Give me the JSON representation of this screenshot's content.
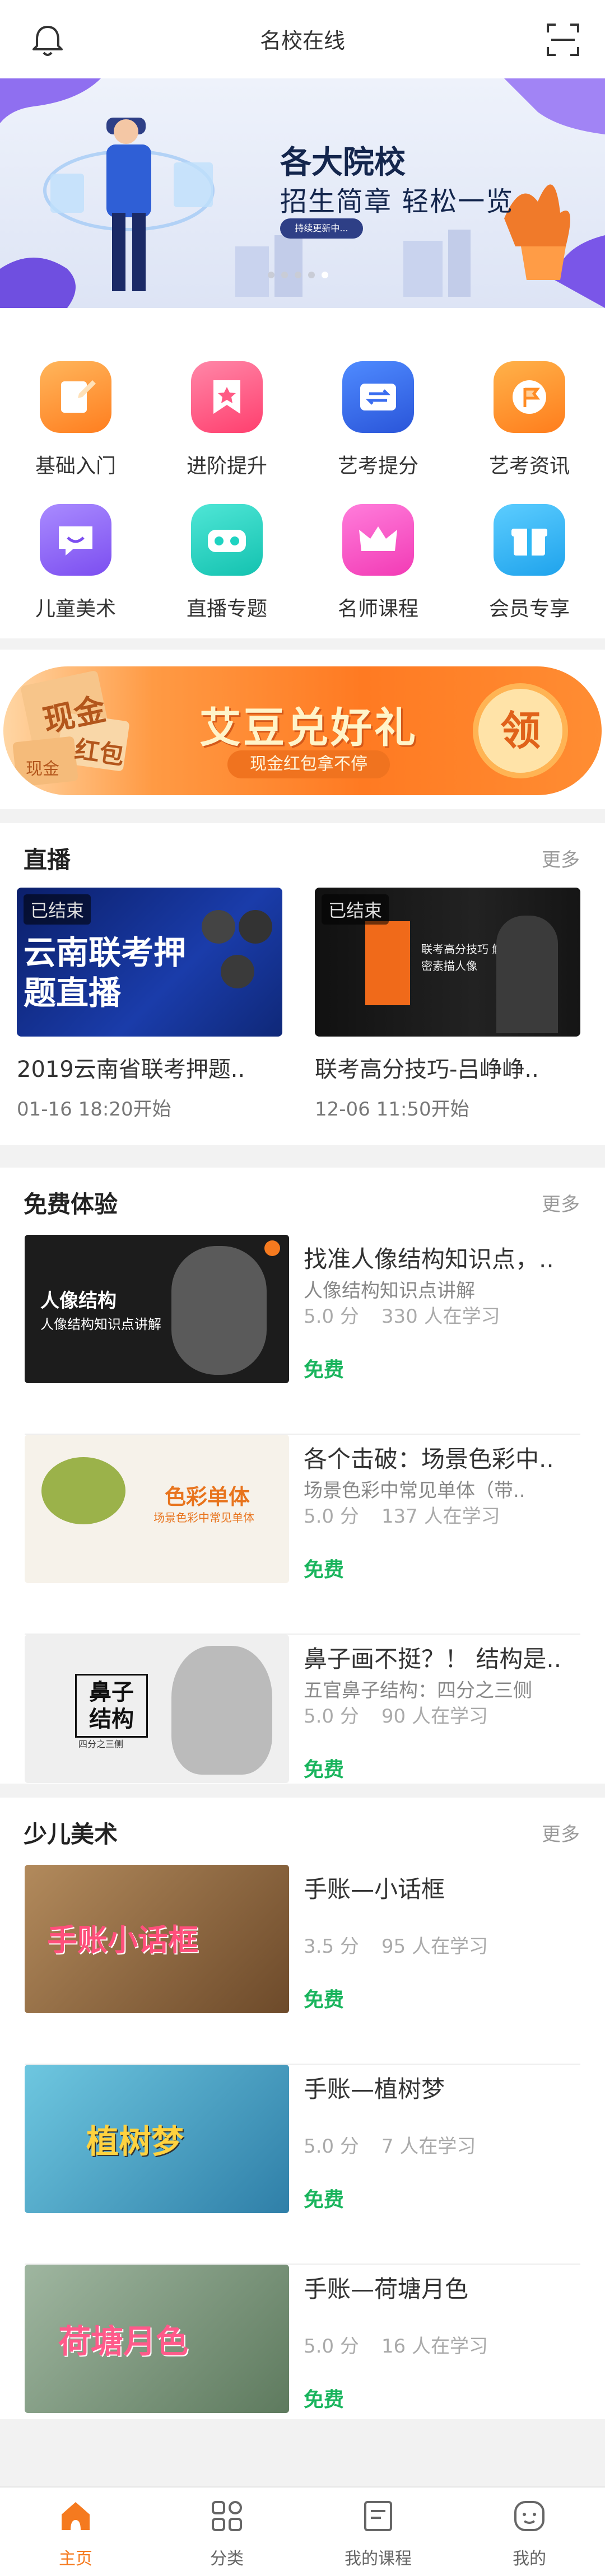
{
  "header": {
    "title": "名校在线",
    "bell_icon": "bell-icon",
    "scan_icon": "scan-icon"
  },
  "banner": {
    "title": "各大院校",
    "subtitle": "招生简章 轻松一览",
    "button_label": "持续更新中...",
    "dot_count": 5,
    "active_dot": 4
  },
  "categories": [
    {
      "label": "基础入门",
      "icon": "pencil-note-icon",
      "color": "#ff8a2a"
    },
    {
      "label": "进阶提升",
      "icon": "ribbon-icon",
      "color": "#ff4f7b"
    },
    {
      "label": "艺考提分",
      "icon": "card-icon",
      "color": "#3a6df0"
    },
    {
      "label": "艺考资讯",
      "icon": "flag-icon",
      "color": "#ff8c24"
    },
    {
      "label": "儿童美术",
      "icon": "chat-smile-icon",
      "color": "#8b5cf6"
    },
    {
      "label": "直播专题",
      "icon": "vr-icon",
      "color": "#1ed3c1"
    },
    {
      "label": "名师课程",
      "icon": "crown-icon",
      "color": "#ff49c6"
    },
    {
      "label": "会员专享",
      "icon": "gift-icon",
      "color": "#2fb8f5"
    }
  ],
  "promo": {
    "title": "艾豆兑好礼",
    "pill": "现金红包拿不停",
    "coin": "领",
    "tags": [
      "现金",
      "红包",
      "现金"
    ]
  },
  "live": {
    "heading": "直播",
    "more": "更多",
    "items": [
      {
        "tag": "已结束",
        "thumb_text": "云南联考押题直播",
        "title": "2019云南省联考押题..",
        "time": "01-16 18:20开始"
      },
      {
        "tag": "已结束",
        "thumb_text": "联考高分技巧 解密素描人像",
        "title": "联考高分技巧-吕峥峥..",
        "time": "12-06 11:50开始"
      }
    ]
  },
  "free": {
    "heading": "免费体验",
    "more": "更多",
    "items": [
      {
        "thumb_text": "人像结构",
        "thumb_sub": "人像结构知识点讲解",
        "title": "找准人像结构知识点，..",
        "subtitle": "人像结构知识点讲解",
        "score": "5.0 分",
        "learners": "330 人在学习",
        "price": "免费"
      },
      {
        "thumb_text": "色彩单体",
        "thumb_sub": "场景色彩中常见单体",
        "title": "各个击破：场景色彩中..",
        "subtitle": "场景色彩中常见单体（带..",
        "score": "5.0 分",
        "learners": "137 人在学习",
        "price": "免费"
      },
      {
        "thumb_text": "鼻子结构",
        "thumb_sub": "四分之三侧",
        "title": "鼻子画不挺？！ 结构是..",
        "subtitle": "五官鼻子结构：四分之三侧",
        "score": "5.0 分",
        "learners": "90 人在学习",
        "price": "免费"
      }
    ]
  },
  "kids": {
    "heading": "少儿美术",
    "more": "更多",
    "items": [
      {
        "thumb_text": "手账小话框",
        "title": "手账—小话框",
        "score": "3.5 分",
        "learners": "95 人在学习",
        "price": "免费"
      },
      {
        "thumb_text": "植树梦",
        "title": "手账—植树梦",
        "score": "5.0 分",
        "learners": "7 人在学习",
        "price": "免费"
      },
      {
        "thumb_text": "荷塘月色",
        "title": "手账—荷塘月色",
        "score": "5.0 分",
        "learners": "16 人在学习",
        "price": "免费"
      }
    ]
  },
  "tabbar": {
    "items": [
      {
        "label": "主页",
        "icon": "home-icon",
        "active": true
      },
      {
        "label": "分类",
        "icon": "grid-icon",
        "active": false
      },
      {
        "label": "我的课程",
        "icon": "book-icon",
        "active": false
      },
      {
        "label": "我的",
        "icon": "face-icon",
        "active": false
      }
    ]
  },
  "colors": {
    "accent": "#f57a1f",
    "free": "#18b45c",
    "banner_text": "#14264d"
  }
}
